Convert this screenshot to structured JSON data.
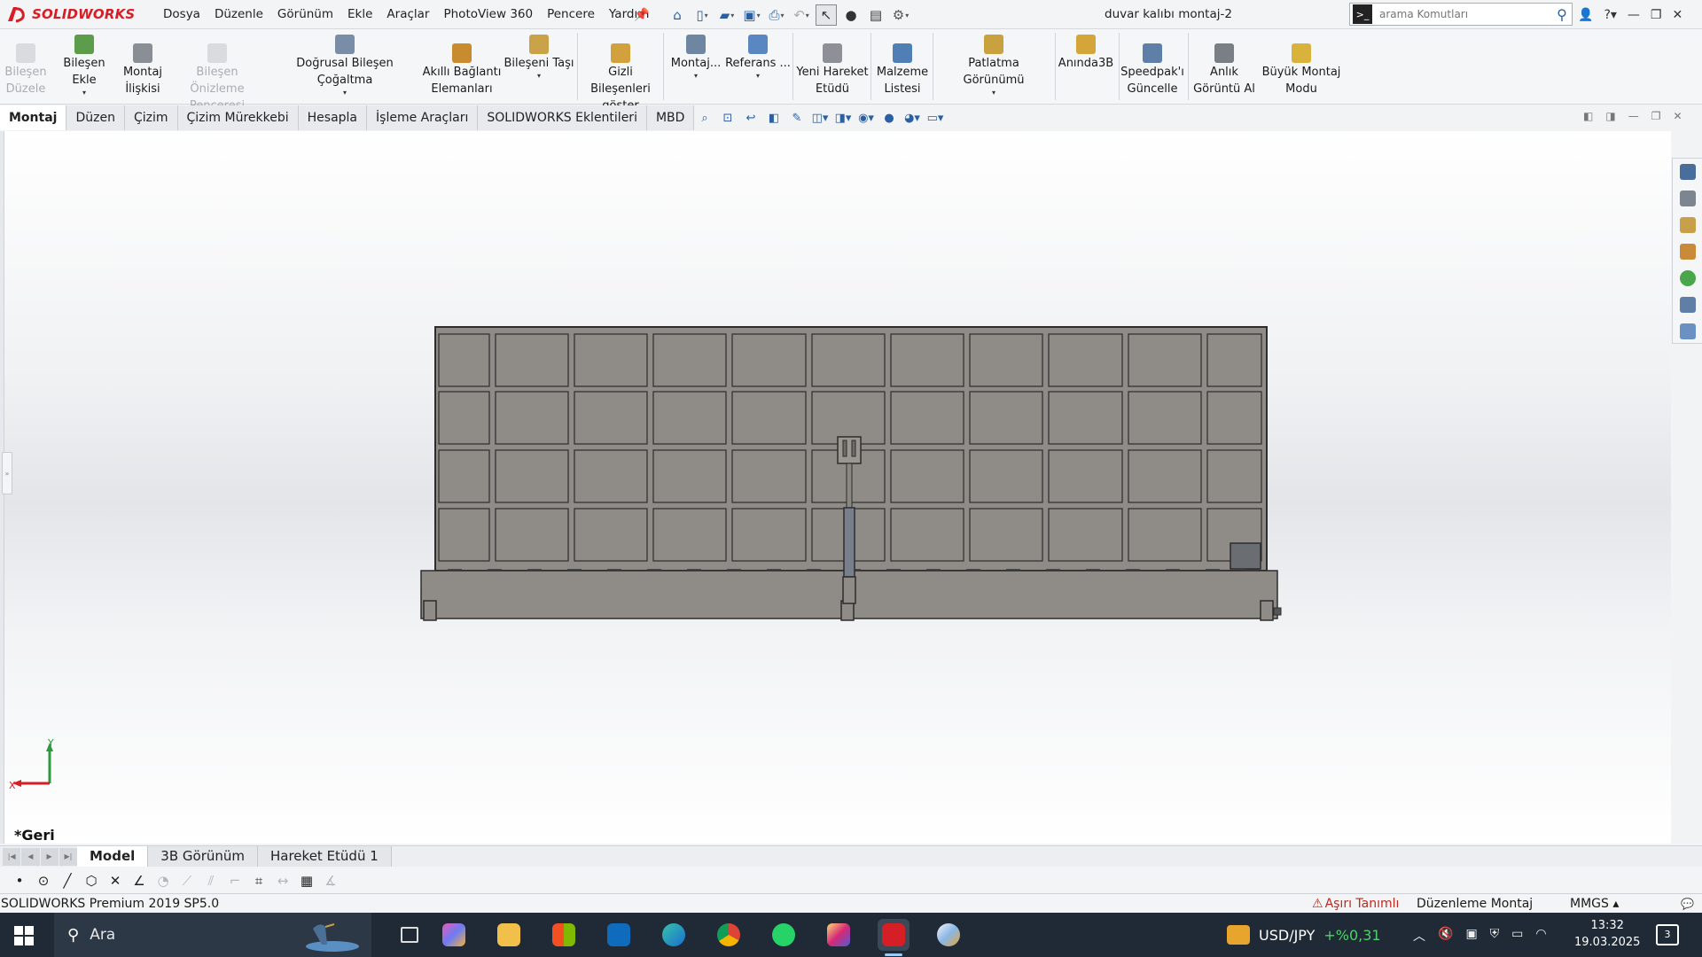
{
  "app": {
    "logo_text": "SOLIDWORKS",
    "document_title": "duvar kalıbı montaj-2"
  },
  "menu": [
    "Dosya",
    "Düzenle",
    "Görünüm",
    "Ekle",
    "Araçlar",
    "PhotoView 360",
    "Pencere",
    "Yardım"
  ],
  "search": {
    "placeholder": "arama Komutları"
  },
  "ribbon": {
    "bilesen_duzele": "Bileşen Düzele",
    "bilesen_ekle": "Bileşen Ekle",
    "montaj_iliskisi": "Montaj İlişkisi",
    "bilesen_onizleme": "Bileşen Önizleme Penceresi",
    "dogrusal": "Doğrusal Bileşen Çoğaltma",
    "akilli": "Akıllı Bağlantı Elemanları",
    "bileseni_tasi": "Bileşeni Taşı",
    "gizli": "Gizli Bileşenleri göster",
    "montaj_dots": "Montaj...",
    "referans": "Referans ...",
    "yeni_hareket": "Yeni Hareket Etüdü",
    "malzeme": "Malzeme Listesi",
    "patlatma": "Patlatma Görünümü",
    "aninda3b": "Anında3B",
    "speedpak": "Speedpak'ı Güncelle",
    "anlik": "Anlık Görüntü Al",
    "buyuk": "Büyük Montaj Modu"
  },
  "tabs": [
    "Montaj",
    "Düzen",
    "Çizim",
    "Çizim Mürekkebi",
    "Hesapla",
    "İşleme Araçları",
    "SOLIDWORKS Eklentileri",
    "MBD"
  ],
  "viewport": {
    "breadcrumb": "*Geri",
    "triad_x": "X",
    "triad_y": "Y"
  },
  "bottom_tabs": [
    "Model",
    "3B Görünüm",
    "Hareket Etüdü 1"
  ],
  "status": {
    "version": "SOLIDWORKS Premium 2019 SP5.0",
    "warning": "Aşırı Tanımlı",
    "mode": "Düzenleme Montaj",
    "units": "MMGS"
  },
  "taskbar": {
    "search_placeholder": "Ara",
    "ticker_symbol": "USD/JPY",
    "ticker_change": "+%0,31",
    "time": "13:32",
    "date": "19.03.2025",
    "notifications": "3"
  },
  "colors": {
    "accent": "#d51e26",
    "model_fill": "#8f8b86",
    "model_stroke": "#2d2d2d",
    "taskbar": "#1f2a36"
  }
}
